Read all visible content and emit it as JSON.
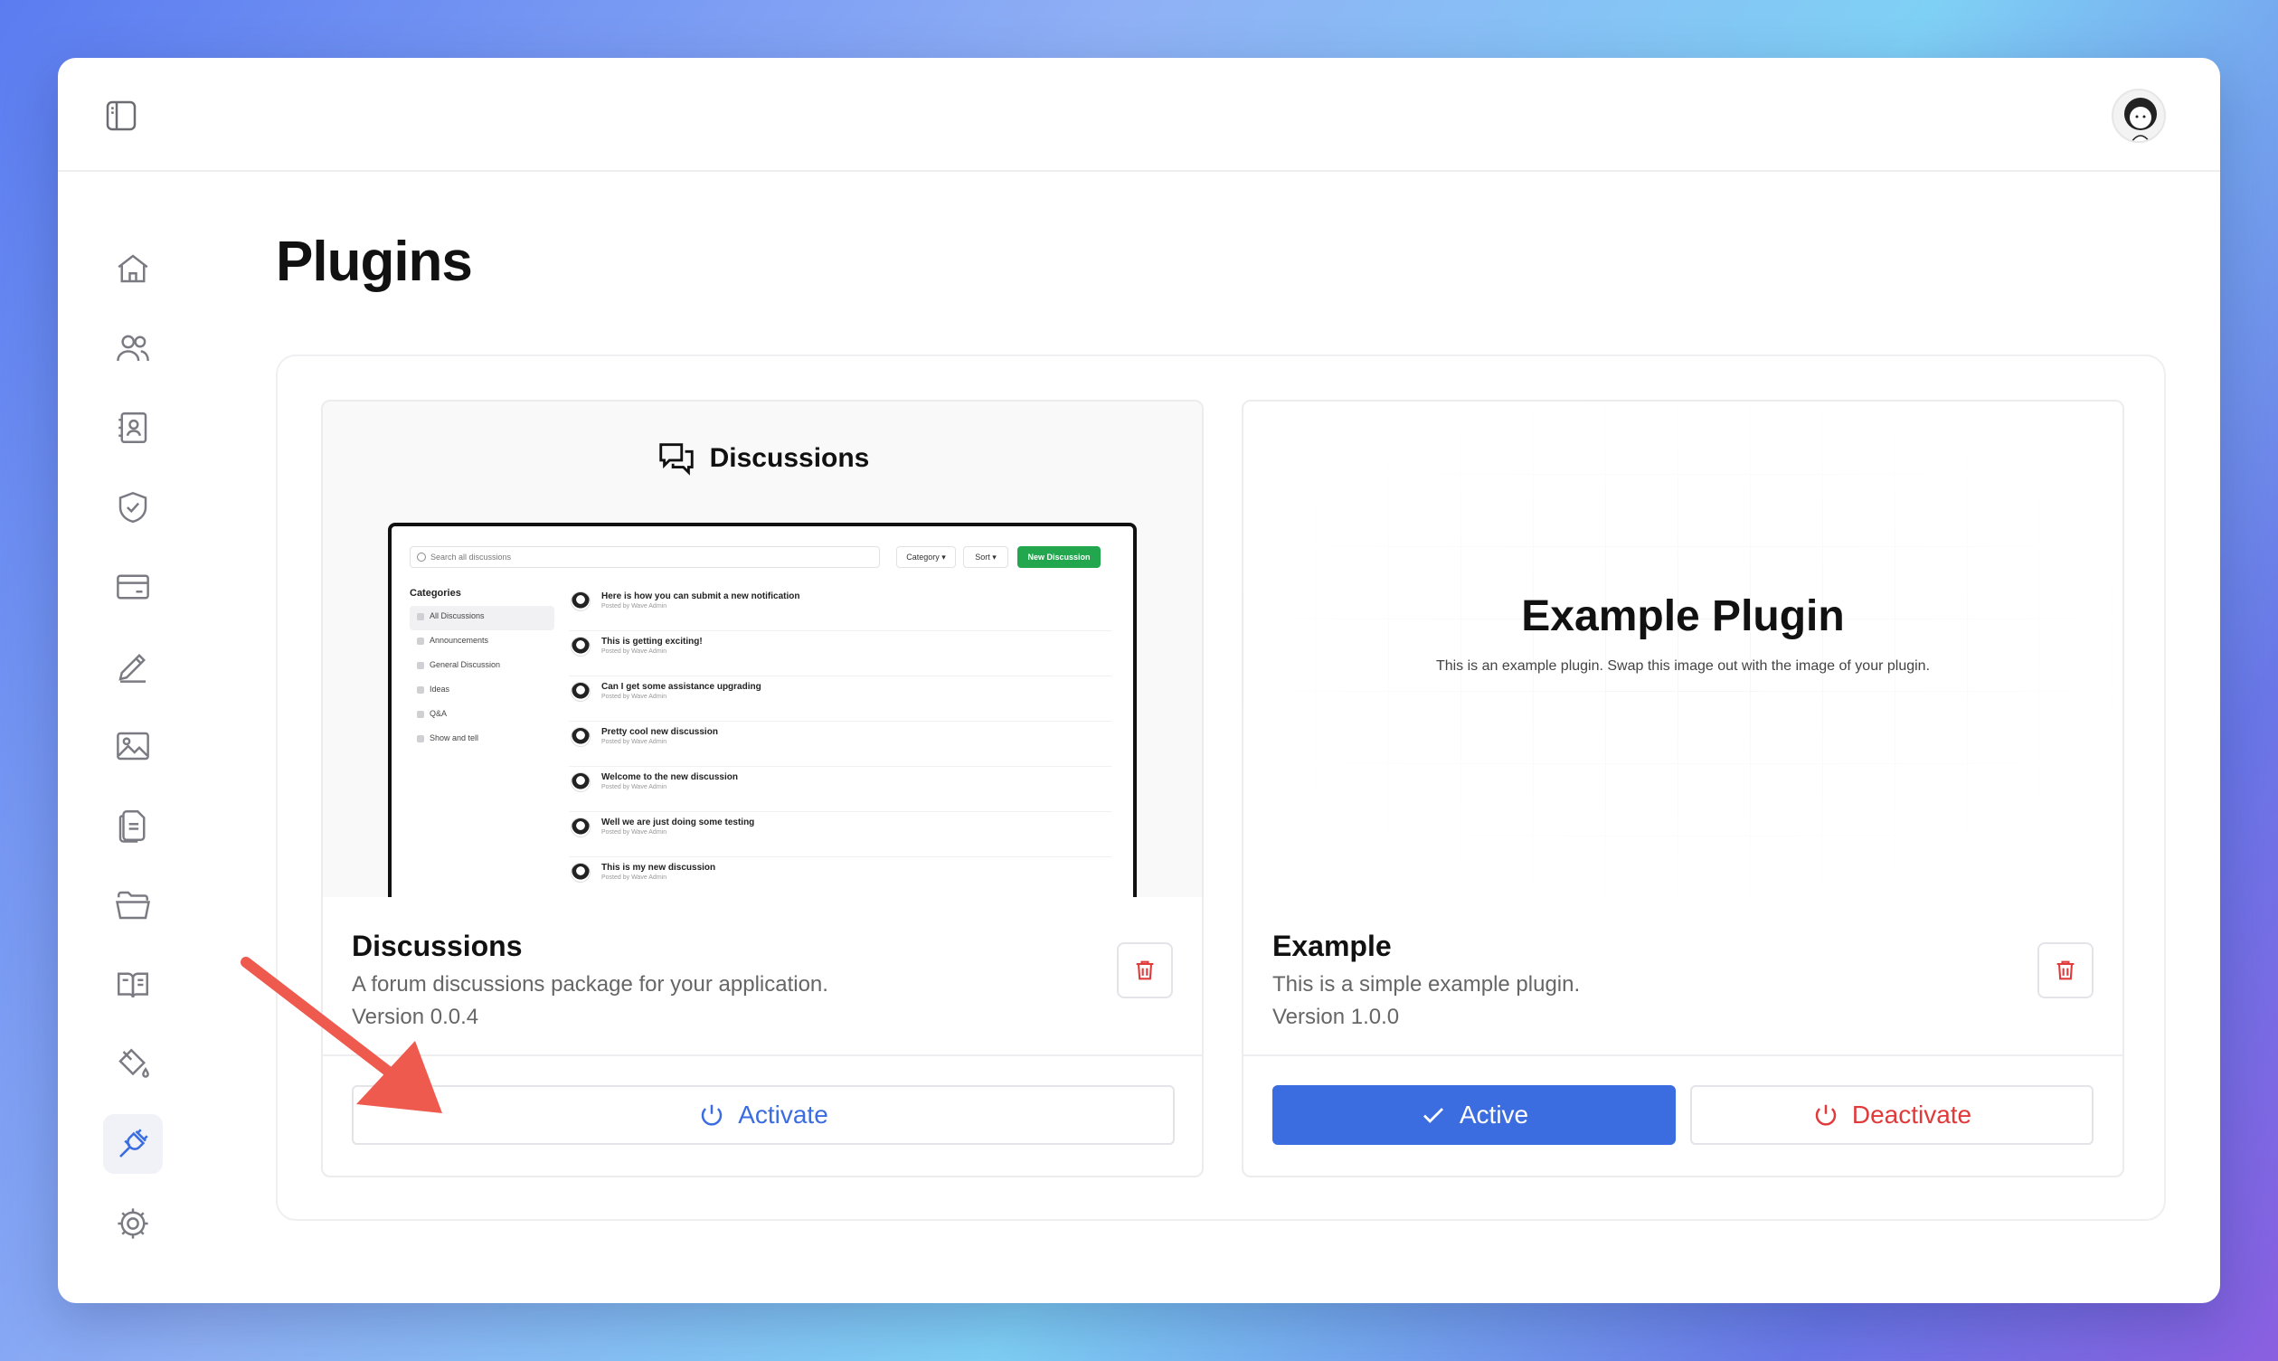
{
  "page": {
    "title": "Plugins"
  },
  "sidebar": {
    "items": [
      {
        "name": "home",
        "icon": "home-icon"
      },
      {
        "name": "users",
        "icon": "users-icon"
      },
      {
        "name": "contacts",
        "icon": "contact-book-icon"
      },
      {
        "name": "roles",
        "icon": "shield-check-icon"
      },
      {
        "name": "billing",
        "icon": "credit-card-icon"
      },
      {
        "name": "posts",
        "icon": "pencil-icon"
      },
      {
        "name": "media",
        "icon": "image-icon"
      },
      {
        "name": "pages",
        "icon": "document-icon"
      },
      {
        "name": "files",
        "icon": "folder-icon"
      },
      {
        "name": "docs",
        "icon": "book-open-icon"
      },
      {
        "name": "themes",
        "icon": "paint-bucket-icon"
      },
      {
        "name": "plugins",
        "icon": "plug-icon",
        "active": true
      },
      {
        "name": "settings",
        "icon": "gear-icon"
      }
    ]
  },
  "plugins": [
    {
      "preview_title": "Discussions",
      "name": "Discussions",
      "description": "A forum discussions package for your application.",
      "version": "Version 0.0.4",
      "status": "inactive",
      "activate_label": "Activate",
      "mini": {
        "search_placeholder": "Search all discussions",
        "category_btn": "Category ▾",
        "sort_btn": "Sort ▾",
        "new_btn": "New Discussion",
        "categories_heading": "Categories",
        "categories": [
          "All Discussions",
          "Announcements",
          "General Discussion",
          "Ideas",
          "Q&A",
          "Show and tell"
        ],
        "posted_by": "Posted by Wave Admin",
        "discussions": [
          "Here is how you can submit a new notification",
          "This is getting exciting!",
          "Can I get some assistance upgrading",
          "Pretty cool new discussion",
          "Welcome to the new discussion",
          "Well we are just doing some testing",
          "This is my new discussion"
        ]
      }
    },
    {
      "preview_title": "Example Plugin",
      "preview_subtitle": "This is an example plugin. Swap this image out with the image of your plugin.",
      "name": "Example",
      "description": "This is a simple example plugin.",
      "version": "Version 1.0.0",
      "status": "active",
      "active_label": "Active",
      "deactivate_label": "Deactivate"
    }
  ],
  "colors": {
    "accent": "#3b6de0",
    "danger": "#e03a3a",
    "annotation_arrow": "#ef5a4f"
  }
}
